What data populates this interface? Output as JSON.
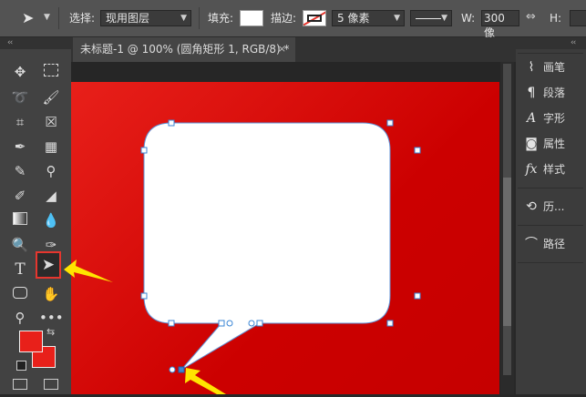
{
  "options_bar": {
    "select_label": "选择:",
    "select_value": "现用图层",
    "fill_label": "填充:",
    "stroke_label": "描边:",
    "stroke_width_value": "5 像素",
    "width_label": "W:",
    "width_value": "300 像",
    "height_label": "H:"
  },
  "document_tab": {
    "title": "未标题-1 @ 100% (圆角矩形 1, RGB/8) *",
    "close_glyph": "×"
  },
  "collapse_glyph": "‹‹",
  "right_panel": {
    "items": [
      {
        "icon": "brush-icon",
        "label": "画笔"
      },
      {
        "icon": "pilcrow-icon",
        "label": "段落"
      },
      {
        "icon": "character-icon",
        "label": "字形"
      },
      {
        "icon": "properties-icon",
        "label": "属性"
      },
      {
        "icon": "fx-icon",
        "label": "样式"
      },
      {
        "icon": "history-icon",
        "label": "历..."
      },
      {
        "icon": "path-icon",
        "label": "路径"
      }
    ]
  },
  "colors": {
    "foreground": "#e8201a",
    "background": "#e8201a",
    "canvas": "#d41010",
    "arrow": "#ffe400",
    "path_handle": "#3a86d6"
  }
}
